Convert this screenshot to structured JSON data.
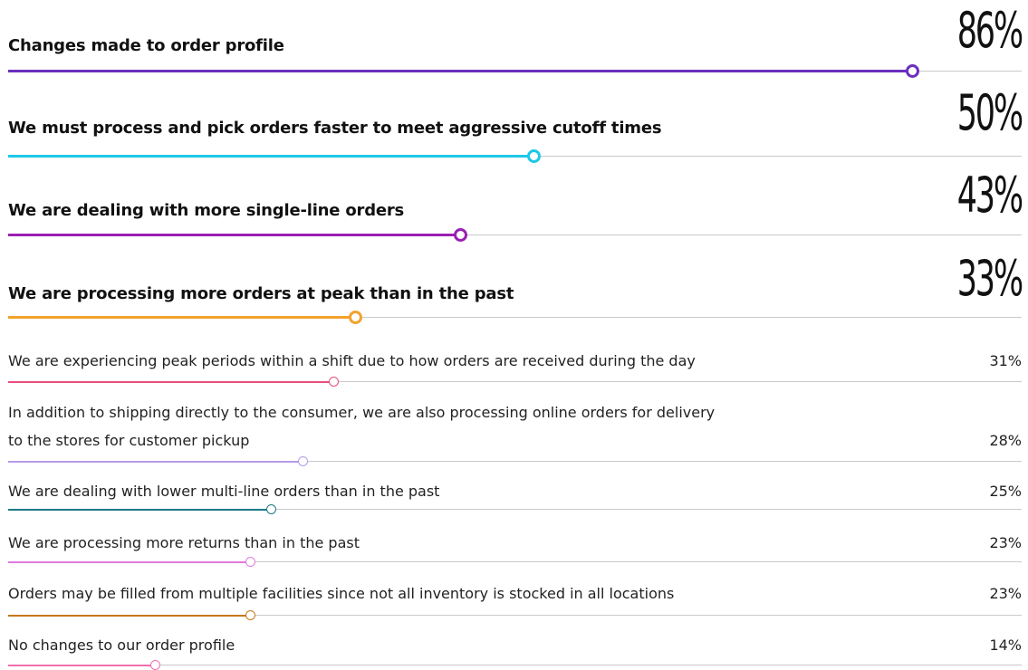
{
  "chart_data": {
    "type": "bar",
    "orientation": "horizontal",
    "x_range": [
      0,
      100
    ],
    "categories": [
      "Changes made to order profile",
      "We must process and pick orders faster  to meet aggressive cutoff times",
      "We are dealing with more single-line orders",
      "We are processing more orders at peak than in the past",
      "We are experiencing peak periods within a shift due to how orders are received during the day",
      "In addition to shipping directly to the consumer, we are also processing online orders for delivery to the stores for customer pickup",
      "We are dealing with lower multi-line orders than in the past",
      "We are processing more returns than in the past",
      "Orders may be filled from multiple facilities since not all inventory is stocked in all locations",
      "No changes to our order profile"
    ],
    "values": [
      86,
      50,
      43,
      33,
      31,
      28,
      25,
      23,
      23,
      14
    ],
    "value_labels": [
      "86%",
      "50%",
      "43%",
      "33%",
      "31%",
      "28%",
      "25%",
      "23%",
      "23%",
      "14%"
    ],
    "colors": [
      "#6c2fbf",
      "#1ec8e6",
      "#9a1fb3",
      "#f2a22c",
      "#e84d7c",
      "#b49be8",
      "#1b7b86",
      "#e07be0",
      "#c4791a",
      "#f06fae"
    ],
    "emphasis": [
      "big",
      "big",
      "big",
      "big",
      "small",
      "small",
      "small",
      "small",
      "small",
      "small"
    ]
  }
}
